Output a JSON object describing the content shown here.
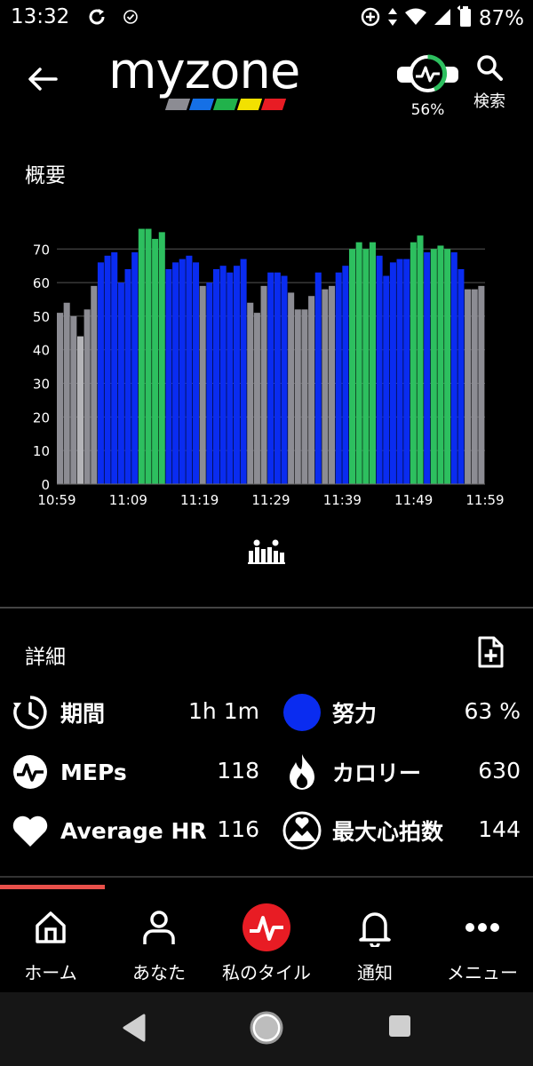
{
  "status_bar": {
    "time": "13:32",
    "battery": "87%"
  },
  "header": {
    "logo": "myzone",
    "effort_percent": "56%",
    "search_label": "検索"
  },
  "overview": {
    "title": "概要"
  },
  "chart_data": {
    "type": "bar",
    "ylim": [
      0,
      78
    ],
    "yticks": [
      "0",
      "10",
      "20",
      "30",
      "40",
      "50",
      "60",
      "70"
    ],
    "xticks": [
      "10:59",
      "11:09",
      "11:19",
      "11:29",
      "11:39",
      "11:49",
      "11:59"
    ],
    "zone_colors": {
      "gray": "#8c8c93",
      "lightgray": "#b4b4b8",
      "blue": "#0a2cf0",
      "green": "#2dbf5f"
    },
    "values": [
      51,
      54,
      50,
      44,
      52,
      59,
      66,
      68,
      69,
      60,
      64,
      69,
      76,
      76,
      73,
      75,
      64,
      66,
      67,
      68,
      66,
      59,
      60,
      64,
      65,
      63,
      65,
      67,
      54,
      51,
      59,
      63,
      63,
      62,
      57,
      52,
      52,
      56,
      63,
      58,
      59,
      63,
      65,
      70,
      72,
      70,
      72,
      68,
      62,
      66,
      67,
      67,
      72,
      74,
      69,
      70,
      71,
      70,
      69,
      64,
      58,
      58,
      59
    ],
    "zones": [
      "gray",
      "gray",
      "gray",
      "lightgray",
      "gray",
      "gray",
      "blue",
      "blue",
      "blue",
      "blue",
      "blue",
      "blue",
      "green",
      "green",
      "green",
      "green",
      "blue",
      "blue",
      "blue",
      "blue",
      "blue",
      "gray",
      "blue",
      "blue",
      "blue",
      "blue",
      "blue",
      "blue",
      "gray",
      "gray",
      "gray",
      "blue",
      "blue",
      "blue",
      "gray",
      "gray",
      "gray",
      "gray",
      "blue",
      "gray",
      "gray",
      "blue",
      "blue",
      "green",
      "green",
      "green",
      "green",
      "blue",
      "blue",
      "blue",
      "blue",
      "blue",
      "green",
      "green",
      "blue",
      "green",
      "green",
      "green",
      "blue",
      "blue",
      "gray",
      "gray",
      "gray"
    ]
  },
  "details": {
    "title": "詳細",
    "stats": {
      "duration": {
        "label": "期間",
        "value": "1h 1m"
      },
      "effort": {
        "label": "努力",
        "value": "63 %"
      },
      "meps": {
        "label": "MEPs",
        "value": "118"
      },
      "calories": {
        "label": "カロリー",
        "value": "630"
      },
      "avg_hr": {
        "label": "Average HR",
        "value": "116"
      },
      "max_hr": {
        "label": "最大心拍数",
        "value": "144"
      }
    }
  },
  "nav": {
    "home": "ホーム",
    "you": "あなた",
    "my_tiles": "私のタイル",
    "notifications": "通知",
    "menu": "メニュー"
  },
  "colors": {
    "accent_red": "#e81c24",
    "nav_indicator": "#e8504a",
    "effort_blue": "#0a2cf0"
  }
}
